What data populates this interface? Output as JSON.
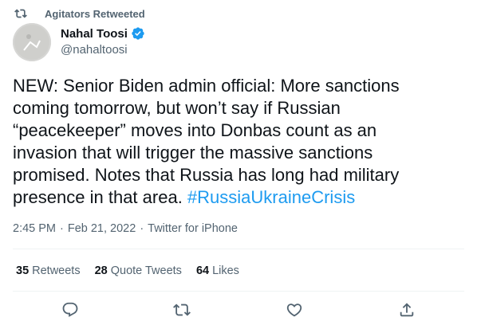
{
  "social_context": {
    "text": "Agitators Retweeted"
  },
  "author": {
    "display_name": "Nahal Toosi",
    "handle": "@nahaltoosi",
    "verified": true
  },
  "tweet": {
    "text_line_1": "NEW: Senior Biden admin official: More sanctions",
    "text_line_2": "coming tomorrow, but won’t say if Russian",
    "text_line_3": "“peacekeeper” moves into Donbas count as an",
    "text_line_4": "invasion that will trigger the massive sanctions",
    "text_line_5": "promised. Notes that Russia has long had military",
    "text_line_6_prefix": "presence in that area. ",
    "hashtag": "#RussiaUkraineCrisis"
  },
  "meta": {
    "time": "2:45 PM",
    "date": "Feb 21, 2022",
    "source": "Twitter for iPhone",
    "separator": "·"
  },
  "stats": {
    "retweets_count": "35",
    "retweets_label": "Retweets",
    "quote_count": "28",
    "quote_label": "Quote Tweets",
    "likes_count": "64",
    "likes_label": "Likes"
  },
  "icons": {
    "retweet": "retweet-icon",
    "verified": "verified-badge-icon",
    "reply": "reply-icon",
    "like": "heart-icon",
    "share": "share-icon"
  },
  "colors": {
    "accent": "#1d9bf0",
    "secondary_text": "#536471",
    "primary_text": "#0f1419"
  }
}
